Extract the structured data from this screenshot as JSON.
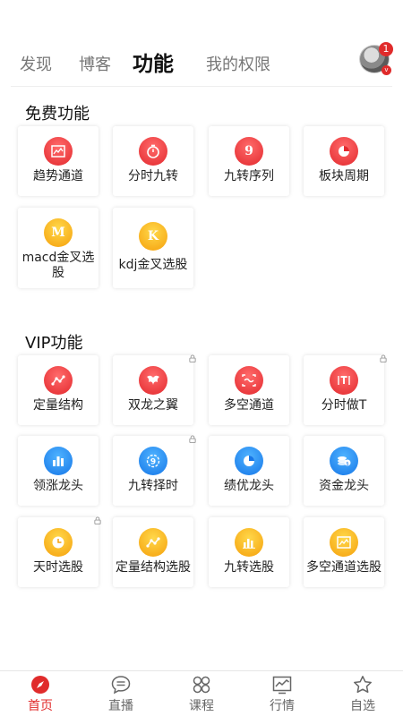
{
  "tabs": [
    {
      "label": "发现",
      "active": false
    },
    {
      "label": "博客",
      "active": false
    },
    {
      "label": "功能",
      "active": true
    },
    {
      "label": "我的权限",
      "active": false
    }
  ],
  "avatar": {
    "badge_count": "1",
    "vip_mark": "v"
  },
  "free_section": {
    "title": "免费功能",
    "items": [
      {
        "label": "趋势通道",
        "icon": "chart-wave-icon",
        "color": "red"
      },
      {
        "label": "分时九转",
        "icon": "stopwatch-icon",
        "color": "red"
      },
      {
        "label": "九转序列",
        "icon": "nine-icon",
        "color": "red",
        "glyph": "9"
      },
      {
        "label": "板块周期",
        "icon": "pie-chart-icon",
        "color": "red"
      },
      {
        "label": "macd金叉选股",
        "icon": "m-letter-icon",
        "color": "yellow",
        "glyph": "M"
      },
      {
        "label": "kdj金叉选股",
        "icon": "k-letter-icon",
        "color": "yellow",
        "glyph": "K"
      }
    ]
  },
  "vip_section": {
    "title": "VIP功能",
    "items": [
      {
        "label": "定量结构",
        "icon": "scatter-icon",
        "color": "red",
        "locked": false
      },
      {
        "label": "双龙之翼",
        "icon": "dragon-icon",
        "color": "red",
        "locked": true
      },
      {
        "label": "多空通道",
        "icon": "channel-icon",
        "color": "red",
        "locked": false
      },
      {
        "label": "分时做T",
        "icon": "t-letter-icon",
        "color": "red",
        "locked": true,
        "glyph": "T"
      },
      {
        "label": "领涨龙头",
        "icon": "bar-chart-icon",
        "color": "blue",
        "locked": false
      },
      {
        "label": "九转择时",
        "icon": "nine-timer-icon",
        "color": "blue",
        "locked": true,
        "glyph": "9"
      },
      {
        "label": "绩优龙头",
        "icon": "pie-chart-icon",
        "color": "blue",
        "locked": false
      },
      {
        "label": "资金龙头",
        "icon": "coins-icon",
        "color": "blue",
        "locked": false
      },
      {
        "label": "天时选股",
        "icon": "clock-icon",
        "color": "yellow",
        "locked": true
      },
      {
        "label": "定量结构选股",
        "icon": "scatter-icon",
        "color": "yellow",
        "locked": false
      },
      {
        "label": "九转选股",
        "icon": "bar-chart-icon",
        "color": "yellow",
        "locked": false
      },
      {
        "label": "多空通道选股",
        "icon": "chart-wave-icon",
        "color": "yellow",
        "locked": false
      }
    ]
  },
  "bottom_nav": [
    {
      "label": "首页",
      "icon": "compass-icon",
      "active": true
    },
    {
      "label": "直播",
      "icon": "chat-bubble-icon",
      "active": false
    },
    {
      "label": "课程",
      "icon": "grid-icon",
      "active": false
    },
    {
      "label": "行情",
      "icon": "line-chart-icon",
      "active": false
    },
    {
      "label": "自选",
      "icon": "star-icon",
      "active": false
    }
  ],
  "colors": {
    "accent": "#e02b2b",
    "red_icon": "#e8353a",
    "yellow_icon": "#f7b51a",
    "blue_icon": "#1e88f0"
  }
}
